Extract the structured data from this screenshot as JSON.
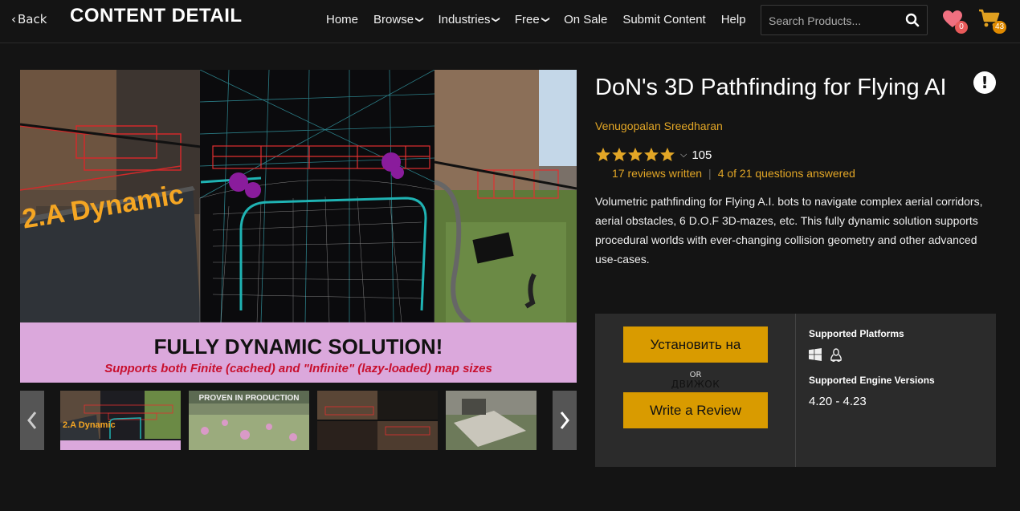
{
  "header": {
    "back_label": "Back",
    "page_heading": "CONTENT DETAIL",
    "nav": [
      {
        "label": "Home",
        "dropdown": false
      },
      {
        "label": "Browse",
        "dropdown": true
      },
      {
        "label": "Industries",
        "dropdown": true
      },
      {
        "label": "Free",
        "dropdown": true
      },
      {
        "label": "On Sale",
        "dropdown": false
      },
      {
        "label": "Submit Content",
        "dropdown": false
      },
      {
        "label": "Help",
        "dropdown": false
      }
    ],
    "search": {
      "placeholder": "Search Products...",
      "value": ""
    },
    "wishlist_count": "0",
    "cart_count": "43",
    "colors": {
      "wishlist_badge": "#e85a5a",
      "cart_badge": "#e08a00",
      "heart": "#f07080",
      "cart": "#e0a020"
    }
  },
  "hero": {
    "sign_text": "2.A Dynamic",
    "banner_title": "FULLY DYNAMIC SOLUTION!",
    "banner_subtitle": "Supports both Finite (cached) and \"Infinite\" (lazy-loaded) map sizes"
  },
  "thumbnails": [
    {
      "caption": ""
    },
    {
      "caption": "PROVEN IN PRODUCTION"
    },
    {
      "caption": ""
    },
    {
      "caption": ""
    }
  ],
  "product": {
    "title": "DoN's 3D Pathfinding for Flying AI",
    "author": "Venugopalan Sreedharan",
    "rating_stars": 5,
    "rating_count": "105",
    "reviews_written": "17 reviews written",
    "questions_answered": "4 of 21 questions answered",
    "description": "Volumetric pathfinding for Flying A.I. bots to navigate complex aerial corridors, aerial obstacles, 6 D.O.F 3D-mazes, etc. This fully dynamic solution supports procedural worlds with ever-changing collision geometry and other advanced use-cases."
  },
  "purchase": {
    "install_label": "Установить на",
    "or_label": "OR",
    "overlay_text": "ДВИЖОК",
    "review_label": "Write a Review",
    "platforms_heading": "Supported Platforms",
    "platform_icons": [
      "windows-icon",
      "linux-icon"
    ],
    "engine_heading": "Supported Engine Versions",
    "engine_versions": "4.20 - 4.23"
  },
  "colors": {
    "accent": "#e2a626",
    "button": "#d99b00",
    "banner": "#dba8dc",
    "banner_subtitle": "#c8102e"
  }
}
